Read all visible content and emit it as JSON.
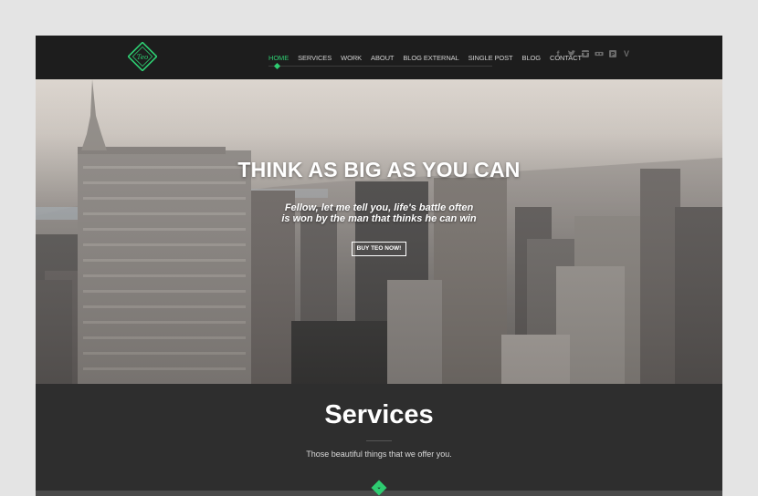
{
  "brand": {
    "logo_text": "Teo"
  },
  "nav": {
    "items": [
      {
        "label": "Home",
        "active": true
      },
      {
        "label": "Services",
        "active": false
      },
      {
        "label": "Work",
        "active": false
      },
      {
        "label": "About",
        "active": false
      },
      {
        "label": "Blog External",
        "active": false
      },
      {
        "label": "Single Post",
        "active": false
      },
      {
        "label": "Blog",
        "active": false
      },
      {
        "label": "Contact",
        "active": false
      }
    ]
  },
  "social": [
    "facebook-icon",
    "twitter-icon",
    "instagram-icon",
    "flickr-icon",
    "pinterest-icon",
    "vimeo-icon"
  ],
  "hero": {
    "title": "THINK AS BIG AS YOU CAN",
    "subtitle_line1": "Fellow, let me tell you, life's battle often",
    "subtitle_line2": "is won by the man that thinks he can win",
    "button_label": "BUY TEO NOW!"
  },
  "services": {
    "title": "Services",
    "subtitle": "Those beautiful things that we offer you."
  },
  "colors": {
    "accent": "#2ecc71",
    "header_bg": "#1d1d1d",
    "section_bg": "#2e2e2e"
  }
}
